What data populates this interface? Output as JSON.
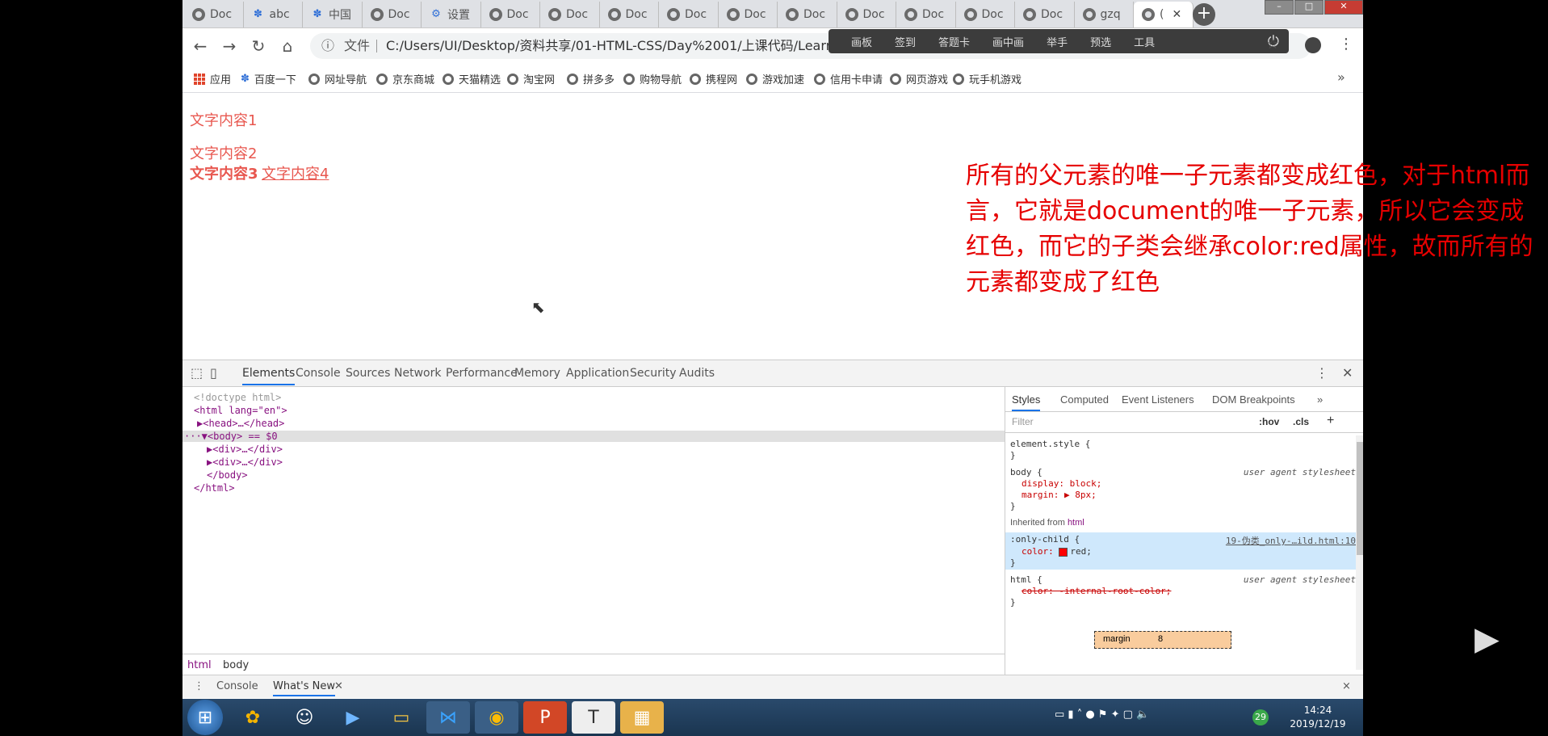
{
  "browser": {
    "tabs": [
      {
        "label": "Doc",
        "icon": "globe-icon"
      },
      {
        "label": "abc",
        "icon": "baidu-paw-icon"
      },
      {
        "label": "中国",
        "icon": "baidu-paw-icon"
      },
      {
        "label": "Doc",
        "icon": "globe-icon"
      },
      {
        "label": "设置",
        "icon": "gear-icon"
      },
      {
        "label": "Doc",
        "icon": "globe-icon"
      },
      {
        "label": "Doc",
        "icon": "globe-icon"
      },
      {
        "label": "Doc",
        "icon": "globe-icon"
      },
      {
        "label": "Doc",
        "icon": "globe-icon"
      },
      {
        "label": "Doc",
        "icon": "globe-icon"
      },
      {
        "label": "Doc",
        "icon": "globe-icon"
      },
      {
        "label": "Doc",
        "icon": "globe-icon"
      },
      {
        "label": "Doc",
        "icon": "globe-icon"
      },
      {
        "label": "Doc",
        "icon": "globe-icon"
      },
      {
        "label": "Doc",
        "icon": "globe-icon"
      },
      {
        "label": "gzq",
        "icon": "globe-icon"
      },
      {
        "label": "(",
        "icon": "globe-icon",
        "active": true
      }
    ],
    "omnibox": {
      "info": "ⓘ",
      "file_label": "文件",
      "url": "C:/Users/UI/Desktop/资料共享/01-HTML-CSS/Day%2001/上课代码/Learn"
    },
    "overlay_toolbar": [
      "画板",
      "签到",
      "答题卡",
      "画中画",
      "举手",
      "预选",
      "工具"
    ],
    "bookmarks": [
      "应用",
      "百度一下",
      "网址导航",
      "京东商城",
      "天猫精选",
      "淘宝网",
      "拼多多",
      "购物导航",
      "携程网",
      "游戏加速",
      "信用卡申请",
      "网页游戏",
      "玩手机游戏"
    ],
    "bookmarks_more": "»"
  },
  "page": {
    "text1": "文字内容1",
    "text2": "文字内容2",
    "text3": "文字内容3",
    "text4": "文字内容4",
    "annotation": "所有的父元素的唯一子元素都变成红色，对于html而言，它就是document的唯一子元素，所以它会变成红色，而它的子类会继承color:red属性，故而所有的元素都变成了红色"
  },
  "devtools": {
    "tabs": [
      "Elements",
      "Console",
      "Sources",
      "Network",
      "Performance",
      "Memory",
      "Application",
      "Security",
      "Audits"
    ],
    "dom": [
      "<!doctype html>",
      "<html lang=\"en\">",
      "▶<head>…</head>",
      "···▼<body> == $0",
      "▶<div>…</div>",
      "▶<div>…</div>",
      "</body>",
      "</html>"
    ],
    "breadcrumbs": [
      "html",
      "body"
    ],
    "styles_tabs": [
      "Styles",
      "Computed",
      "Event Listeners",
      "DOM Breakpoints",
      "»"
    ],
    "filter_placeholder": "Filter",
    "filter_hov": ":hov",
    "filter_cls": ".cls",
    "filter_plus": "+",
    "rules": {
      "element_style_open": "element.style {",
      "close": "}",
      "body_selector": "body {",
      "body_source": "user agent stylesheet",
      "body_prop1": "display: block;",
      "body_prop2": "margin: ▶ 8px;",
      "inherited_label": "Inherited from",
      "inherited_tag": "html",
      "only_child_selector": ":only-child {",
      "only_child_source": "19-伪类_only-…ild.html:10",
      "only_child_prop": "color:",
      "only_child_value": "red;",
      "html_selector": "html {",
      "html_source": "user agent stylesheet",
      "html_prop": "color: -internal-root-color;"
    },
    "boxmodel_label": "margin",
    "boxmodel_value": "8",
    "drawer_tabs": [
      "Console",
      "What's New"
    ],
    "drawer_close": "×"
  },
  "taskbar": {
    "clock_time": "14:24",
    "clock_date": "2019/12/19",
    "tray_badge": "29"
  },
  "colors": {
    "page_text": "#e8574f",
    "annotation": "#e60000",
    "devtools_accent": "#1a73e8"
  }
}
